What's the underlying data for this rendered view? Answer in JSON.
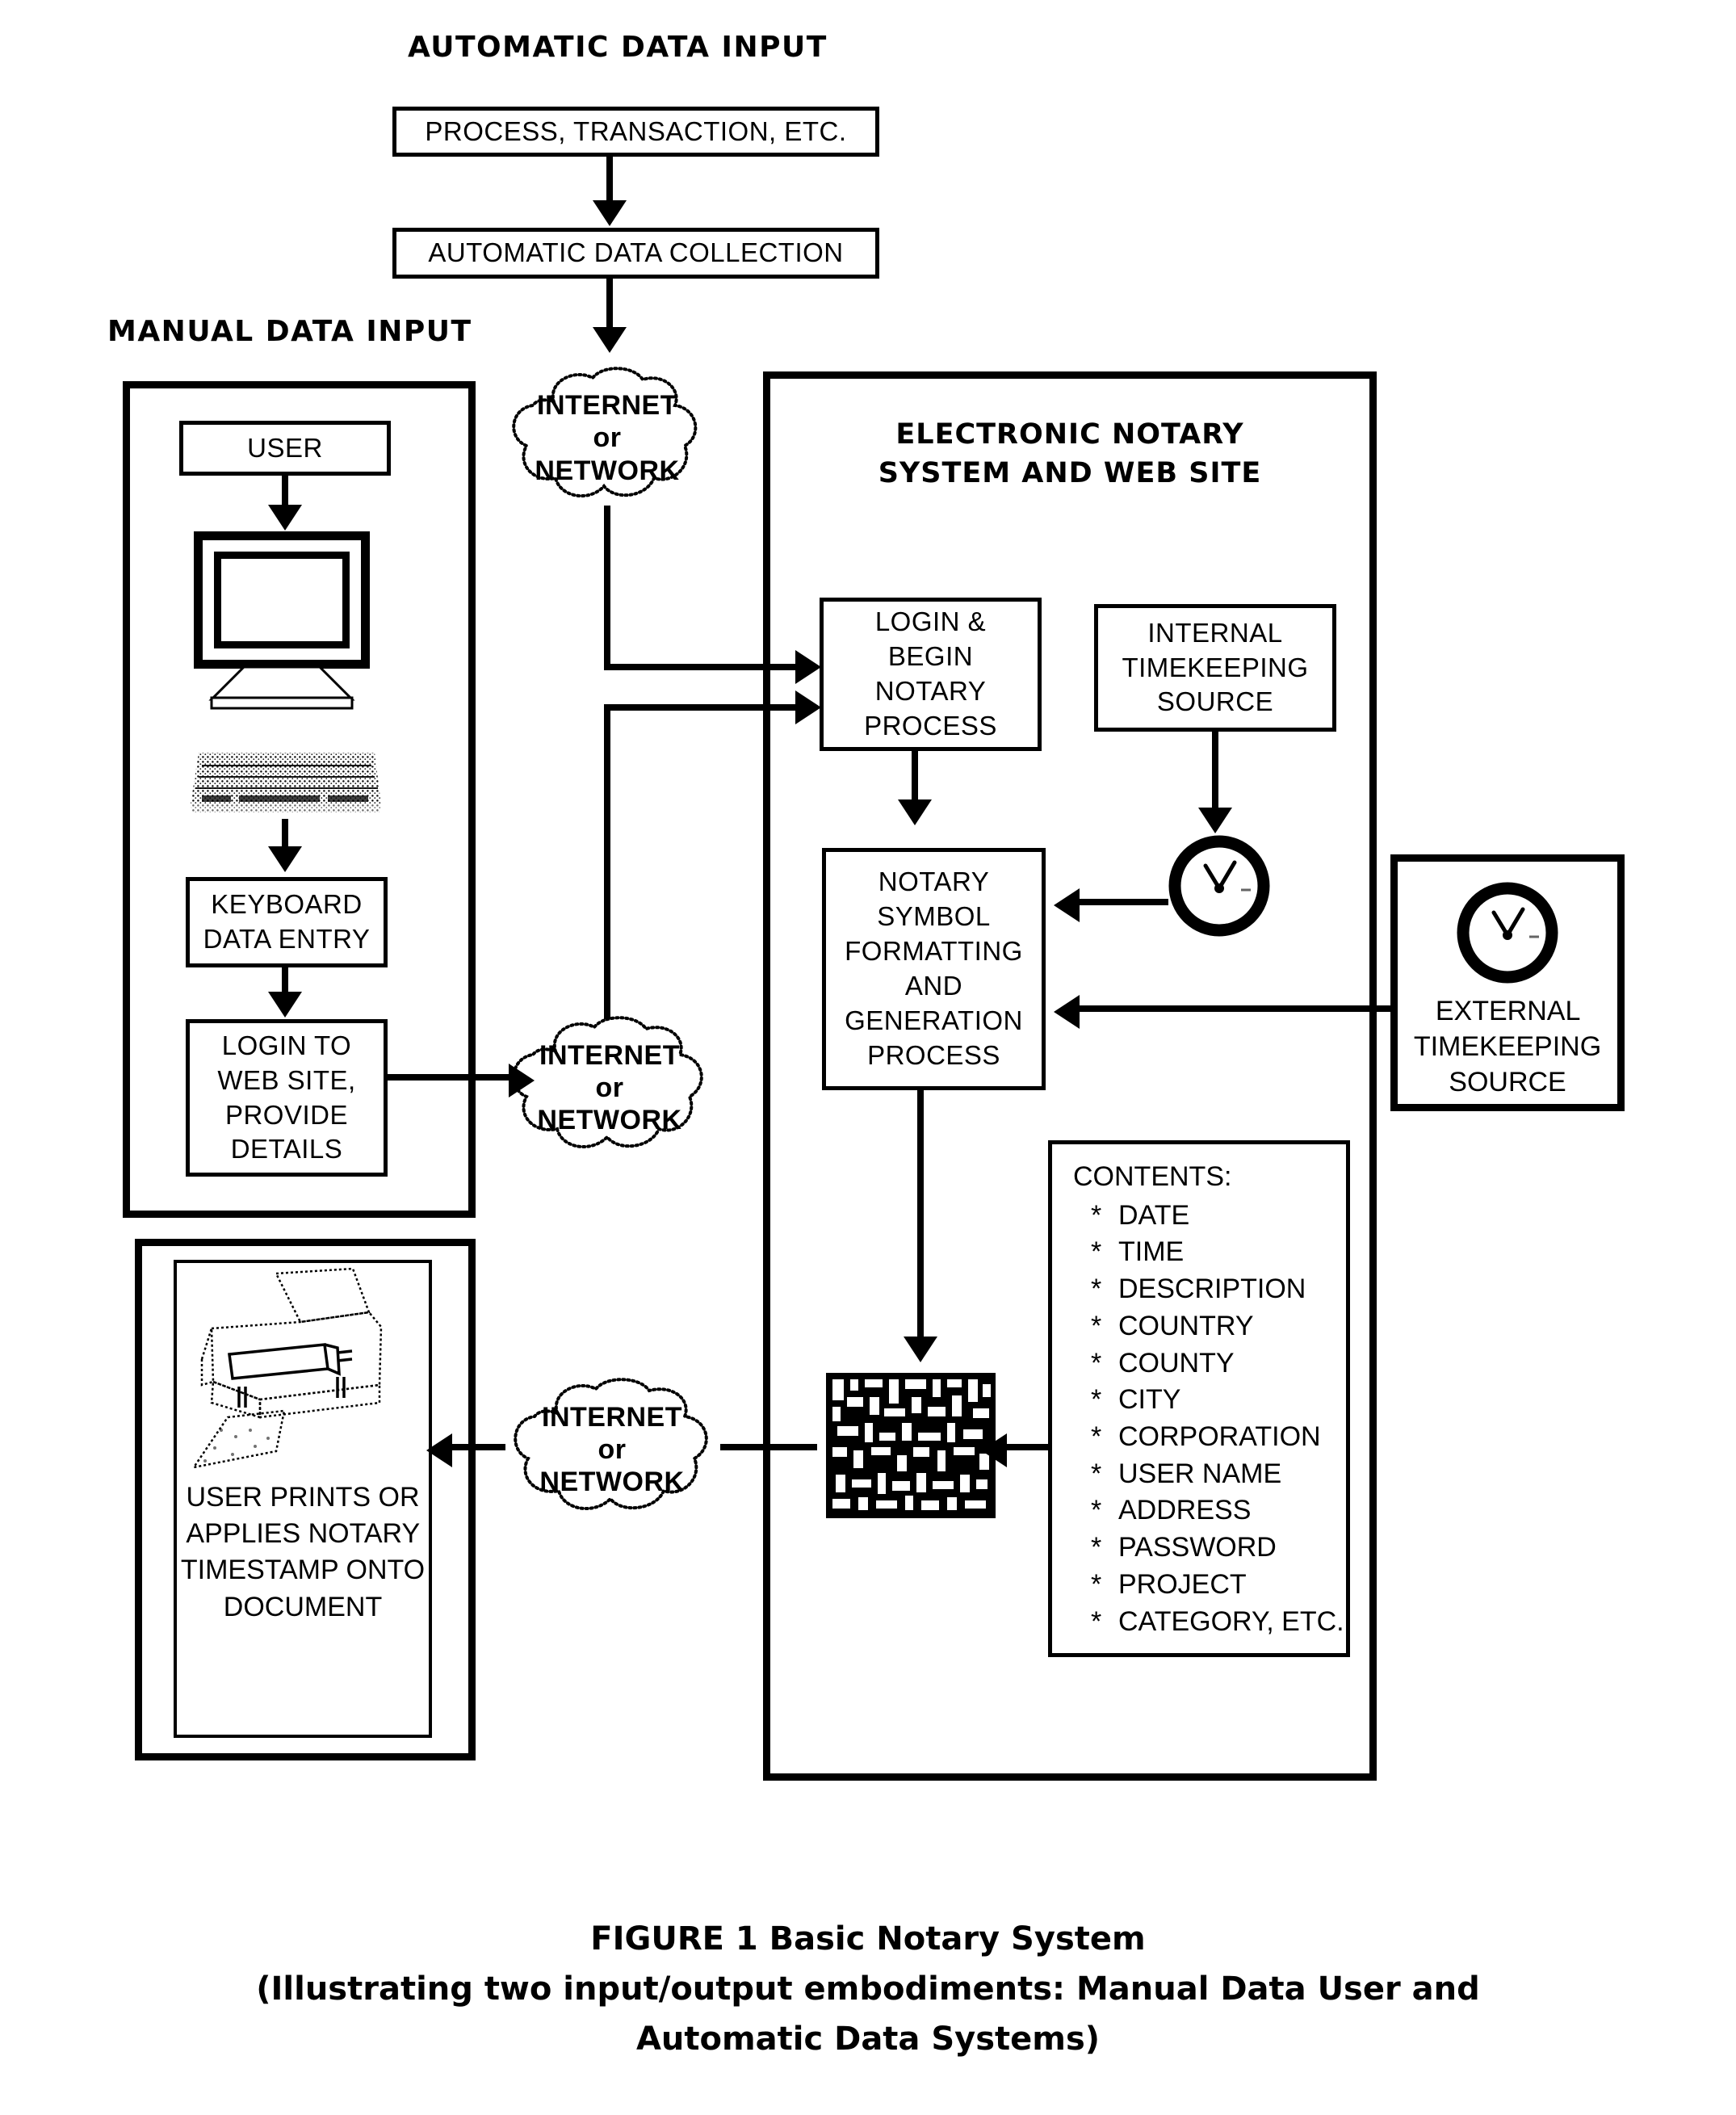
{
  "figure": {
    "caption_line1": "FIGURE 1  Basic Notary System",
    "caption_line2": "(Illustrating two input/output embodiments: Manual Data User and",
    "caption_line3": "Automatic Data Systems)"
  },
  "sections": {
    "automatic_data_input": "AUTOMATIC DATA INPUT",
    "manual_data_input": "MANUAL DATA INPUT",
    "electronic_notary_system": [
      "ELECTRONIC",
      "NOTARY",
      "SYSTEM AND",
      "WEB SITE"
    ]
  },
  "boxes": {
    "process_transaction": "PROCESS, TRANSACTION, ETC.",
    "automatic_data_collection": "AUTOMATIC DATA COLLECTION",
    "user": "USER",
    "keyboard_data_entry": [
      "KEYBOARD",
      "DATA ENTRY"
    ],
    "login_to_web_site": [
      "LOGIN TO",
      "WEB SITE,",
      "PROVIDE",
      "DETAILS"
    ],
    "user_prints": [
      "USER PRINTS",
      "OR APPLIES",
      "NOTARY",
      "TIMESTAMP",
      "ONTO",
      "DOCUMENT"
    ],
    "login_begin_notary": [
      "LOGIN &",
      "BEGIN",
      "NOTARY",
      "PROCESS"
    ],
    "internal_timekeeping": [
      "INTERNAL",
      "TIMEKEEPING",
      "SOURCE"
    ],
    "external_timekeeping": [
      "EXTERNAL",
      "TIMEKEEPING",
      "SOURCE"
    ],
    "notary_symbol_process": [
      "NOTARY",
      "SYMBOL",
      "FORMATTING",
      "AND",
      "GENERATION",
      "PROCESS"
    ]
  },
  "clouds": {
    "top": {
      "line1": "INTERNET",
      "line2": "or",
      "line3": "NETWORK"
    },
    "middle": {
      "line1": "INTERNET",
      "line2": "or",
      "line3": "NETWORK"
    },
    "bottom": {
      "line1": "INTERNET",
      "line2": "or",
      "line3": "NETWORK"
    }
  },
  "contents": {
    "header": "CONTENTS:",
    "items": [
      "DATE",
      "TIME",
      "DESCRIPTION",
      "COUNTRY",
      "COUNTY",
      "CITY",
      "CORPORATION",
      "USER NAME",
      "ADDRESS",
      "PASSWORD",
      "PROJECT",
      "CATEGORY,  ETC."
    ],
    "bullet": "*"
  },
  "icons": {
    "monitor": "computer-monitor-icon",
    "keyboard": "keyboard-icon",
    "printer": "printer-icon",
    "clock_internal": "clock-icon",
    "clock_external": "clock-icon",
    "barcode": "2d-barcode-glyph"
  },
  "colors": {
    "ink": "#000000",
    "paper": "#ffffff"
  }
}
